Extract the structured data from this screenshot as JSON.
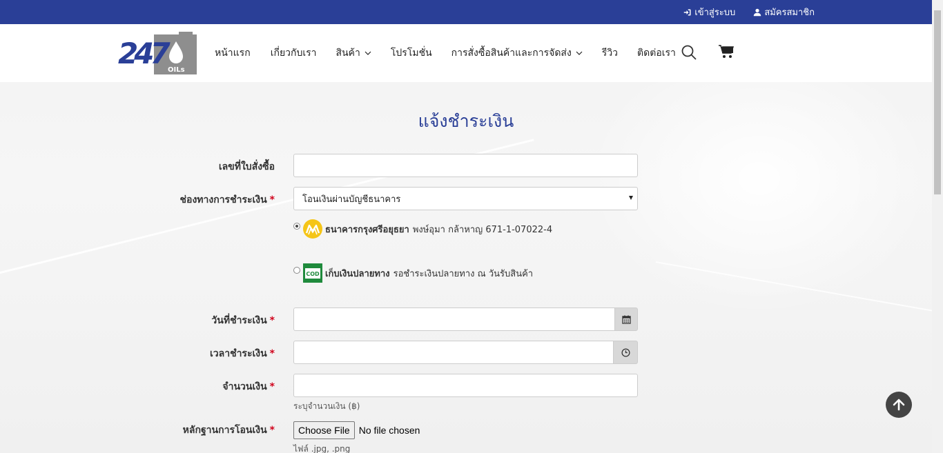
{
  "topbar": {
    "login_label": "เข้าสู่ระบบ",
    "register_label": "สมัครสมาชิก"
  },
  "header": {
    "logo_text": "247",
    "logo_subtext": "OILs",
    "nav": [
      {
        "label": "หน้าแรก"
      },
      {
        "label": "เกี่ยวกับเรา"
      },
      {
        "label": "สินค้า",
        "dropdown": true
      },
      {
        "label": "โปรโมชั่น"
      },
      {
        "label": "การสั่งซื้อสินค้าและการจัดส่ง",
        "dropdown": true
      },
      {
        "label": "รีวิว"
      },
      {
        "label": "ติดต่อเรา"
      }
    ],
    "icons": [
      "search-icon",
      "cart-icon"
    ]
  },
  "form": {
    "title": "แจ้งชำระเงิน",
    "order_no": {
      "label": "เลขที่ใบสั่งซื้อ",
      "value": ""
    },
    "payment_channel": {
      "label": "ช่องทางการชำระเงิน",
      "required": "*",
      "value": "โอนเงินผ่านบัญชีธนาคาร"
    },
    "options": [
      {
        "name": "ธนาคารกรุงศรีอยุธยา",
        "detail": "พงษ์อุมา กล้าหาญ 671-1-07022-4",
        "checked": true
      },
      {
        "name": "เก็บเงินปลายทาง",
        "detail": "รอชำระเงินปลายทาง ณ วันรับสินค้า",
        "checked": false
      }
    ],
    "pay_date": {
      "label": "วันที่ชำระเงิน",
      "required": "*",
      "value": ""
    },
    "pay_time": {
      "label": "เวลาชำระเงิน",
      "required": "*",
      "value": ""
    },
    "amount": {
      "label": "จำนวนเงิน",
      "required": "*",
      "value": "",
      "hint": "ระบุจำนวนเงิน (฿)"
    },
    "evidence": {
      "label": "หลักฐานการโอนเงิน",
      "required": "*",
      "button": "Choose File",
      "status": "No file chosen",
      "hint": "ไฟล์ .jpg, .png"
    }
  },
  "colors": {
    "brand": "#2a3f97",
    "required": "#d0021b",
    "cod_green": "#1f8a3c",
    "bank_yellow": "#f5c518"
  }
}
